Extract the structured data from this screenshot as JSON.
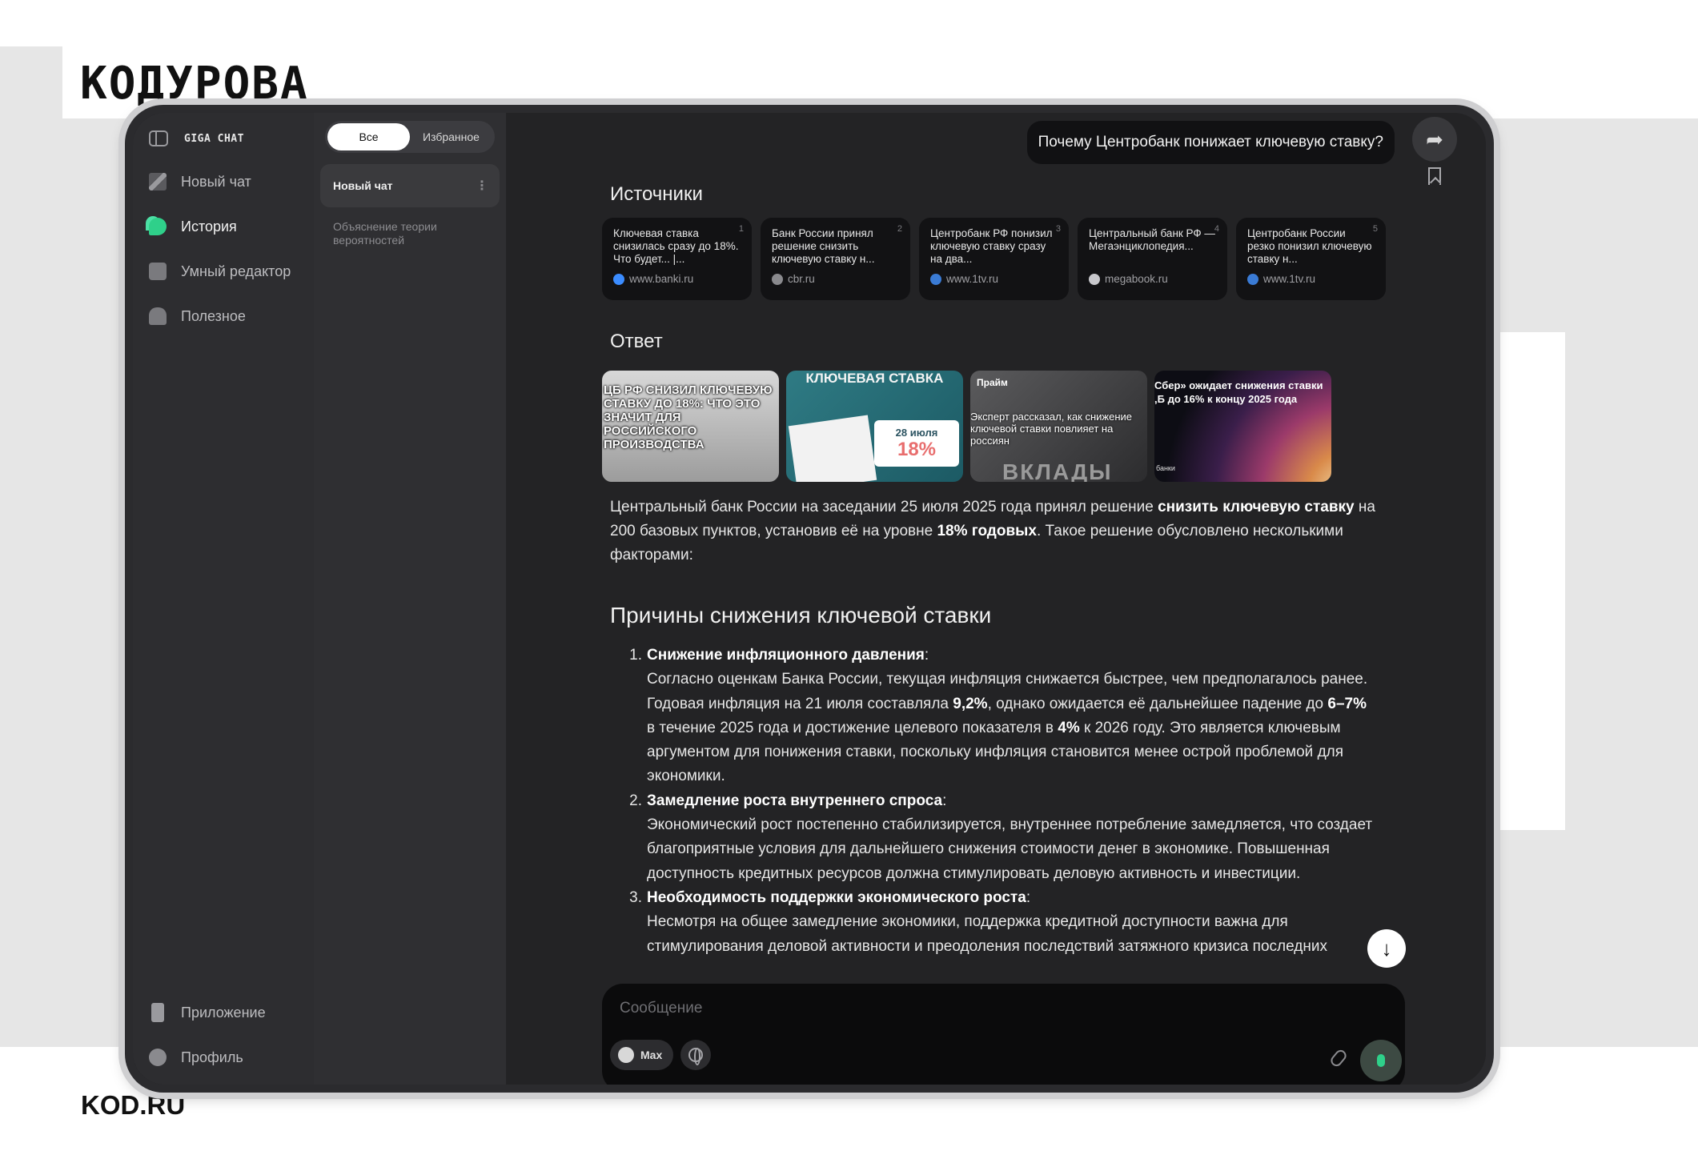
{
  "brand": {
    "logo_text": "KOДУРОВА",
    "footer_text": "KOD.RU"
  },
  "sidebar": {
    "app_logo": "GIGA CHAT",
    "items": [
      {
        "label": "Новый чат",
        "icon": "pencil-icon"
      },
      {
        "label": "История",
        "icon": "history-icon"
      },
      {
        "label": "Умный редактор",
        "icon": "editor-icon"
      },
      {
        "label": "Полезное",
        "icon": "useful-icon"
      }
    ],
    "bottom_items": [
      {
        "label": "Приложение",
        "icon": "phone-icon"
      },
      {
        "label": "Профиль",
        "icon": "profile-icon"
      }
    ]
  },
  "history": {
    "filters": [
      "Все",
      "Избранное"
    ],
    "active_filter": "Все",
    "chats": [
      "Новый чат",
      "Объяснение теории вероятностей"
    ]
  },
  "chat": {
    "user_message": "Почему Центробанк понижает ключевую ставку?",
    "sources_title": "Источники",
    "sources": [
      {
        "n": "1",
        "title": "Ключевая ставка снизилась сразу до 18%. Что будет... |...",
        "site": "www.banki.ru",
        "favicon_color": "#3b8cff"
      },
      {
        "n": "2",
        "title": "Банк России принял решение снизить ключевую ставку н...",
        "site": "cbr.ru",
        "favicon_color": "#8a8a8e"
      },
      {
        "n": "3",
        "title": "Центробанк РФ понизил ключевую ставку сразу на два...",
        "site": "www.1tv.ru",
        "favicon_color": "#3a7bd5"
      },
      {
        "n": "4",
        "title": "Центральный банк РФ — Мегаэнциклопедия...",
        "site": "megabook.ru",
        "favicon_color": "#c8c8cc"
      },
      {
        "n": "5",
        "title": "Центробанк России резко понизил ключевую ставку н...",
        "site": "www.1tv.ru",
        "favicon_color": "#3a7bd5"
      }
    ],
    "answer_title": "Ответ",
    "images": {
      "img1_caption": "ЦБ РФ СНИЗИЛ КЛЮЧЕВУЮ СТАВКУ ДО 18%: ЧТО ЭТО ЗНАЧИТ ДЛЯ РОССИЙСКОГО ПРОИЗВОДСТВА",
      "img2_title": "КЛЮЧЕВАЯ СТАВКА",
      "img2_date": "28 июля",
      "img2_value": "18%",
      "img3_brand": "Прайм",
      "img3_caption": "Эксперт рассказал, как снижение ключевой ставки повлияет на россиян",
      "img3_word": "ВКЛАДЫ",
      "img4_caption": "Сбер» ожидает снижения ставки ,Б до 16% к концу 2025 года",
      "img4_logo": "банки"
    },
    "intro": {
      "p1": "Центральный банк России на заседании 25 июля 2025 года принял решение ",
      "b1": "снизить ключевую ставку",
      "p2": " на 200 базовых пунктов, установив её на уровне ",
      "b2": "18% годовых",
      "p3": ". Такое решение обусловлено несколькими факторами:"
    },
    "reasons_title": "Причины снижения ключевой ставки",
    "reasons": [
      {
        "n": "1.",
        "title": "Снижение инфляционного давления",
        "t1": "Согласно оценкам Банка России, текущая инфляция снижается быстрее, чем предполагалось ранее. Годовая инфляция на 21 июля составляла ",
        "b1": "9,2%",
        "t2": ", однако ожидается её дальнейшее падение до ",
        "b2": "6–7%",
        "t3": " в течение 2025 года и достижение целевого показателя в ",
        "b3": "4%",
        "t4": " к 2026 году. Это является ключевым аргументом для понижения ставки, поскольку инфляция становится менее острой проблемой для экономики."
      },
      {
        "n": "2.",
        "title": "Замедление роста внутреннего спроса",
        "text": "Экономический рост постепенно стабилизируется, внутреннее потребление замедляется, что создает благоприятные условия для дальнейшего снижения стоимости денег в экономике. Повышенная доступность кредитных ресурсов должна стимулировать деловую активность и инвестиции."
      },
      {
        "n": "3.",
        "title": "Необходимость поддержки экономического роста",
        "text": "Несмотря на общее замедление экономики, поддержка кредитной доступности важна для стимулирования деловой активности и преодоления последствий затяжного кризиса последних"
      }
    ]
  },
  "composer": {
    "placeholder": "Сообщение",
    "model": "Max"
  },
  "colors": {
    "accent_green": "#2fd08a",
    "background_dark": "#232325",
    "sidebar": "#2d2d30"
  }
}
